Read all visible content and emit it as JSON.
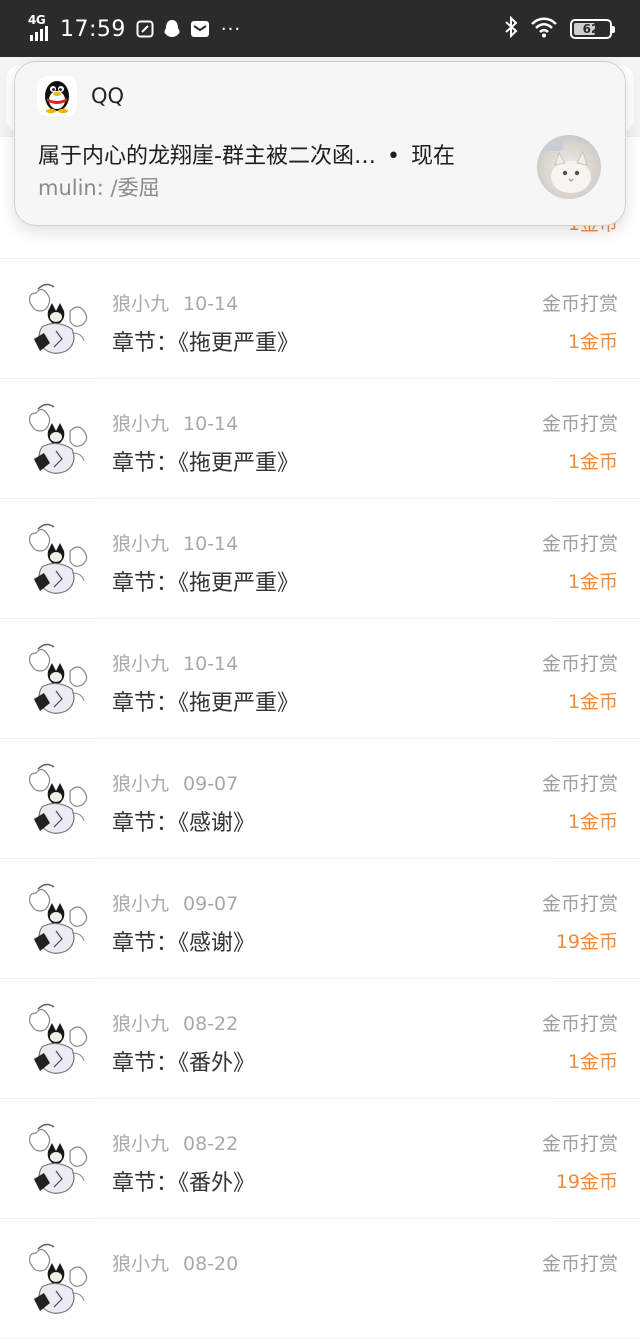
{
  "status_bar": {
    "network": "4G",
    "time": "17:59",
    "more": "···",
    "battery": "62",
    "battery_fraction": 0.62
  },
  "notification": {
    "app_name": "QQ",
    "title": "属于内心的龙翔崖-群主被二次函…",
    "separator": "•",
    "time": "现在",
    "body": "mulin: /委屈"
  },
  "partial_top_row": {
    "amount": "1金币"
  },
  "rewards": [
    {
      "user": "狼小九",
      "date": "10-14",
      "chapter": "章节：《拖更严重》",
      "type": "金币打赏",
      "amount": "1金币"
    },
    {
      "user": "狼小九",
      "date": "10-14",
      "chapter": "章节：《拖更严重》",
      "type": "金币打赏",
      "amount": "1金币"
    },
    {
      "user": "狼小九",
      "date": "10-14",
      "chapter": "章节：《拖更严重》",
      "type": "金币打赏",
      "amount": "1金币"
    },
    {
      "user": "狼小九",
      "date": "10-14",
      "chapter": "章节：《拖更严重》",
      "type": "金币打赏",
      "amount": "1金币"
    },
    {
      "user": "狼小九",
      "date": "09-07",
      "chapter": "章节：《感谢》",
      "type": "金币打赏",
      "amount": "1金币"
    },
    {
      "user": "狼小九",
      "date": "09-07",
      "chapter": "章节：《感谢》",
      "type": "金币打赏",
      "amount": "19金币"
    },
    {
      "user": "狼小九",
      "date": "08-22",
      "chapter": "章节：《番外》",
      "type": "金币打赏",
      "amount": "1金币"
    },
    {
      "user": "狼小九",
      "date": "08-22",
      "chapter": "章节：《番外》",
      "type": "金币打赏",
      "amount": "19金币"
    },
    {
      "user": "狼小九",
      "date": "08-20",
      "chapter": "",
      "type": "金币打赏",
      "amount": ""
    }
  ],
  "colors": {
    "amount": "#f08a3c",
    "status_bar": "#2b2b2b"
  },
  "icons": {
    "signal": "signal-icon",
    "notif_app": "qq-penguin-icon",
    "bluetooth": "bluetooth-icon",
    "wifi": "wifi-icon",
    "battery": "battery-icon"
  }
}
